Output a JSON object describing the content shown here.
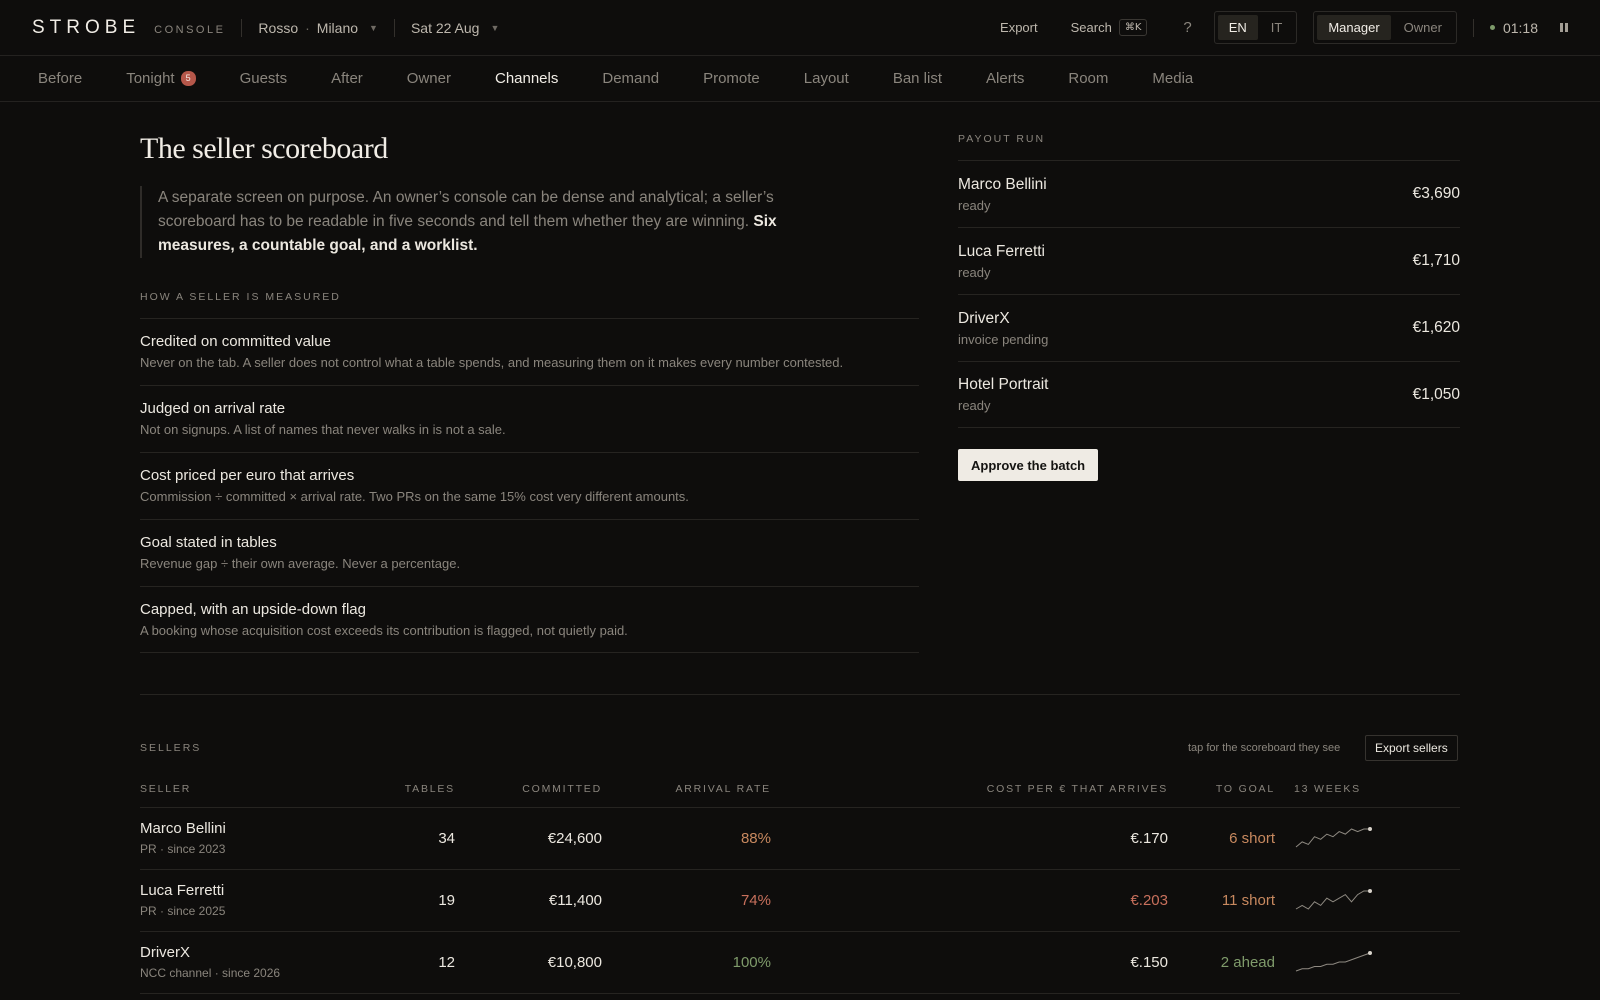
{
  "topbar": {
    "brand": "STROBE",
    "brand_sub": "CONSOLE",
    "venue": "Rosso",
    "venue_sep": "·",
    "city": "Milano",
    "date": "Sat 22 Aug",
    "export_label": "Export",
    "search_label": "Search",
    "search_kbd": "⌘K",
    "help_label": "?",
    "languages": [
      "EN",
      "IT"
    ],
    "active_language": "EN",
    "roles": [
      "Manager",
      "Owner"
    ],
    "active_role": "Manager",
    "clock": "01:18"
  },
  "nav": {
    "items": [
      "Before",
      "Tonight",
      "Guests",
      "After",
      "Owner",
      "Channels",
      "Demand",
      "Promote",
      "Layout",
      "Ban list",
      "Alerts",
      "Room",
      "Media"
    ],
    "active": "Channels",
    "tonight_badge": "5"
  },
  "page": {
    "title": "The seller scoreboard",
    "intro": "A separate screen on purpose. An owner’s console can be dense and analytical; a seller’s scoreboard has to be readable in five seconds and tell them whether they are winning.",
    "intro_strong": "Six measures, a countable goal, and a worklist."
  },
  "measures": {
    "heading": "How a seller is measured",
    "items": [
      {
        "title": "Credited on committed value",
        "desc": "Never on the tab. A seller does not control what a table spends, and measuring them on it makes every number contested."
      },
      {
        "title": "Judged on arrival rate",
        "desc": "Not on signups. A list of names that never walks in is not a sale."
      },
      {
        "title": "Cost priced per euro that arrives",
        "desc": "Commission ÷ committed × arrival rate. Two PRs on the same 15% cost very different amounts."
      },
      {
        "title": "Goal stated in tables",
        "desc": "Revenue gap ÷ their own average. Never a percentage."
      },
      {
        "title": "Capped, with an upside-down flag",
        "desc": "A booking whose acquisition cost exceeds its contribution is flagged, not quietly paid."
      }
    ]
  },
  "payout": {
    "heading": "Payout run",
    "rows": [
      {
        "name": "Marco Bellini",
        "status": "ready",
        "amount": "€3,690"
      },
      {
        "name": "Luca Ferretti",
        "status": "ready",
        "amount": "€1,710"
      },
      {
        "name": "DriverX",
        "status": "invoice pending",
        "amount": "€1,620"
      },
      {
        "name": "Hotel Portrait",
        "status": "ready",
        "amount": "€1,050"
      }
    ],
    "approve_label": "Approve the batch"
  },
  "sellers": {
    "heading": "Sellers",
    "tap_note": "tap for the scoreboard they see",
    "export_label": "Export sellers",
    "columns": {
      "seller": "SELLER",
      "tables": "TABLES",
      "committed": "COMMITTED",
      "arrival": "ARRIVAL RATE",
      "cost": "COST PER € THAT ARRIVES",
      "goal": "TO GOAL",
      "weeks": "13 WEEKS"
    },
    "colors": {
      "amber": "#c8895f",
      "red": "#c8705c",
      "green": "#7f9b6b",
      "text": "#ece8e0"
    },
    "rows": [
      {
        "name": "Marco Bellini",
        "sub": "PR · since 2023",
        "tables": "34",
        "committed": "€24,600",
        "arrival": "88%",
        "arrival_tone": "amber",
        "cost": "€.170",
        "cost_tone": "text",
        "goal": "6 short",
        "goal_tone": "amber",
        "trend": [
          2,
          4,
          3,
          6,
          5,
          7,
          6,
          8,
          7,
          9,
          8,
          9,
          9
        ]
      },
      {
        "name": "Luca Ferretti",
        "sub": "PR · since 2025",
        "tables": "19",
        "committed": "€11,400",
        "arrival": "74%",
        "arrival_tone": "red",
        "cost": "€.203",
        "cost_tone": "red",
        "goal": "11 short",
        "goal_tone": "amber",
        "trend": [
          3,
          4,
          3,
          5,
          4,
          6,
          5,
          6,
          7,
          5,
          7,
          8,
          8
        ]
      },
      {
        "name": "DriverX",
        "sub": "NCC channel · since 2026",
        "tables": "12",
        "committed": "€10,800",
        "arrival": "100%",
        "arrival_tone": "green",
        "cost": "€.150",
        "cost_tone": "text",
        "goal": "2 ahead",
        "goal_tone": "green",
        "trend": [
          1,
          2,
          2,
          3,
          3,
          4,
          4,
          5,
          5,
          6,
          7,
          8,
          9
        ]
      }
    ]
  }
}
